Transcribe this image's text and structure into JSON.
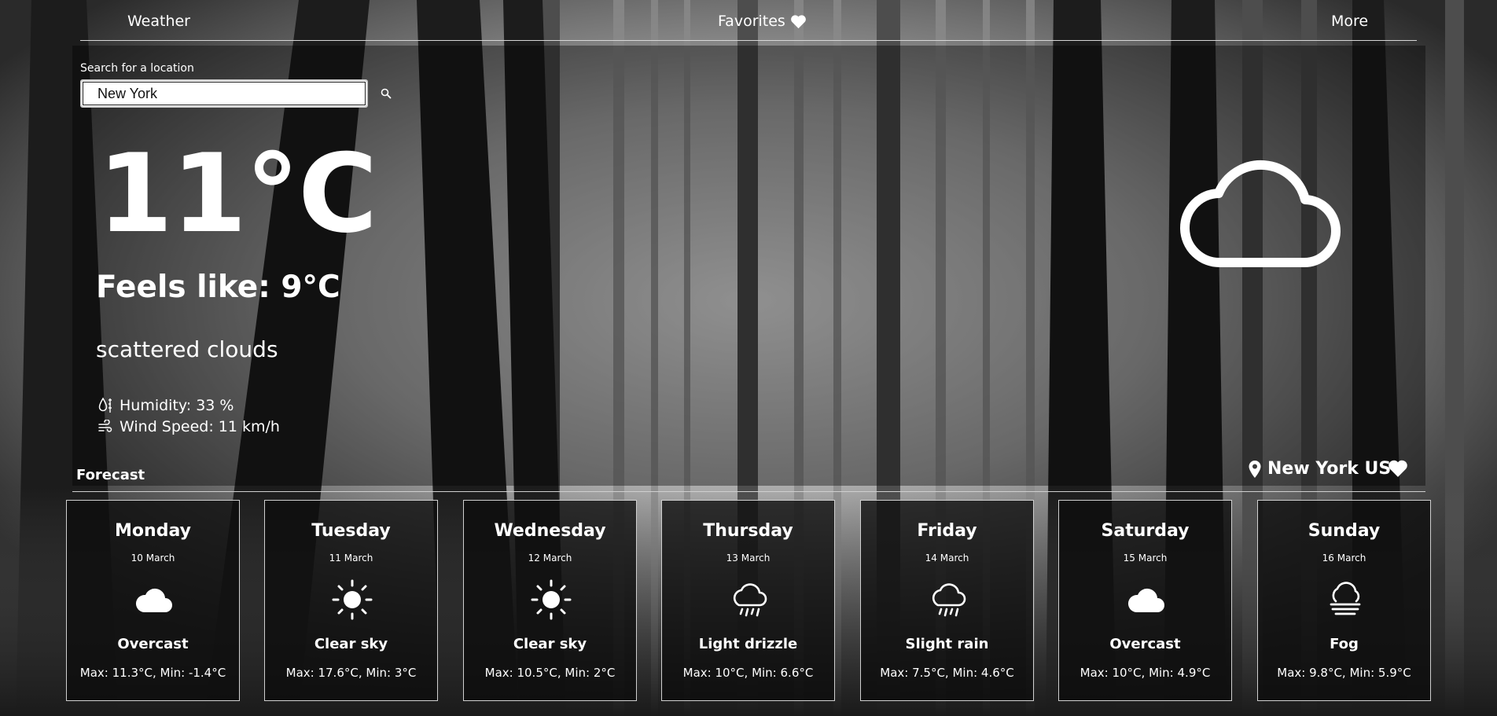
{
  "nav": {
    "weather_label": "Weather",
    "favorites_label": "Favorites",
    "more_label": "More",
    "favorites_icon": "heart-icon"
  },
  "search": {
    "label": "Search for a location",
    "value": "New York",
    "icon": "search-icon"
  },
  "current": {
    "temperature": "11°C",
    "feels_like": "Feels like: 9°C",
    "description": "scattered clouds",
    "humidity": "Humidity: 33 %",
    "wind_speed": "Wind Speed: 11 km/h",
    "icon": "cloud-icon"
  },
  "forecast": {
    "title": "Forecast",
    "location": "New York US",
    "location_icon": "map-pin-icon",
    "favorite_icon": "heart-icon",
    "days": [
      {
        "day": "Monday",
        "date": "10 March",
        "condition": "Overcast",
        "temps": "Max: 11.3°C, Min: -1.4°C",
        "icon": "cloud"
      },
      {
        "day": "Tuesday",
        "date": "11 March",
        "condition": "Clear sky",
        "temps": "Max: 17.6°C, Min: 3°C",
        "icon": "sun"
      },
      {
        "day": "Wednesday",
        "date": "12 March",
        "condition": "Clear sky",
        "temps": "Max: 10.5°C, Min: 2°C",
        "icon": "sun"
      },
      {
        "day": "Thursday",
        "date": "13 March",
        "condition": "Light drizzle",
        "temps": "Max: 10°C, Min: 6.6°C",
        "icon": "rain"
      },
      {
        "day": "Friday",
        "date": "14 March",
        "condition": "Slight rain",
        "temps": "Max: 7.5°C, Min: 4.6°C",
        "icon": "rain"
      },
      {
        "day": "Saturday",
        "date": "15 March",
        "condition": "Overcast",
        "temps": "Max: 10°C, Min: 4.9°C",
        "icon": "cloud"
      },
      {
        "day": "Sunday",
        "date": "16 March",
        "condition": "Fog",
        "temps": "Max: 9.8°C, Min: 5.9°C",
        "icon": "fog"
      }
    ]
  },
  "colors": {
    "text": "#ffffff",
    "card_bg": "#0c0c0c",
    "card_border": "#d0d0d0"
  }
}
